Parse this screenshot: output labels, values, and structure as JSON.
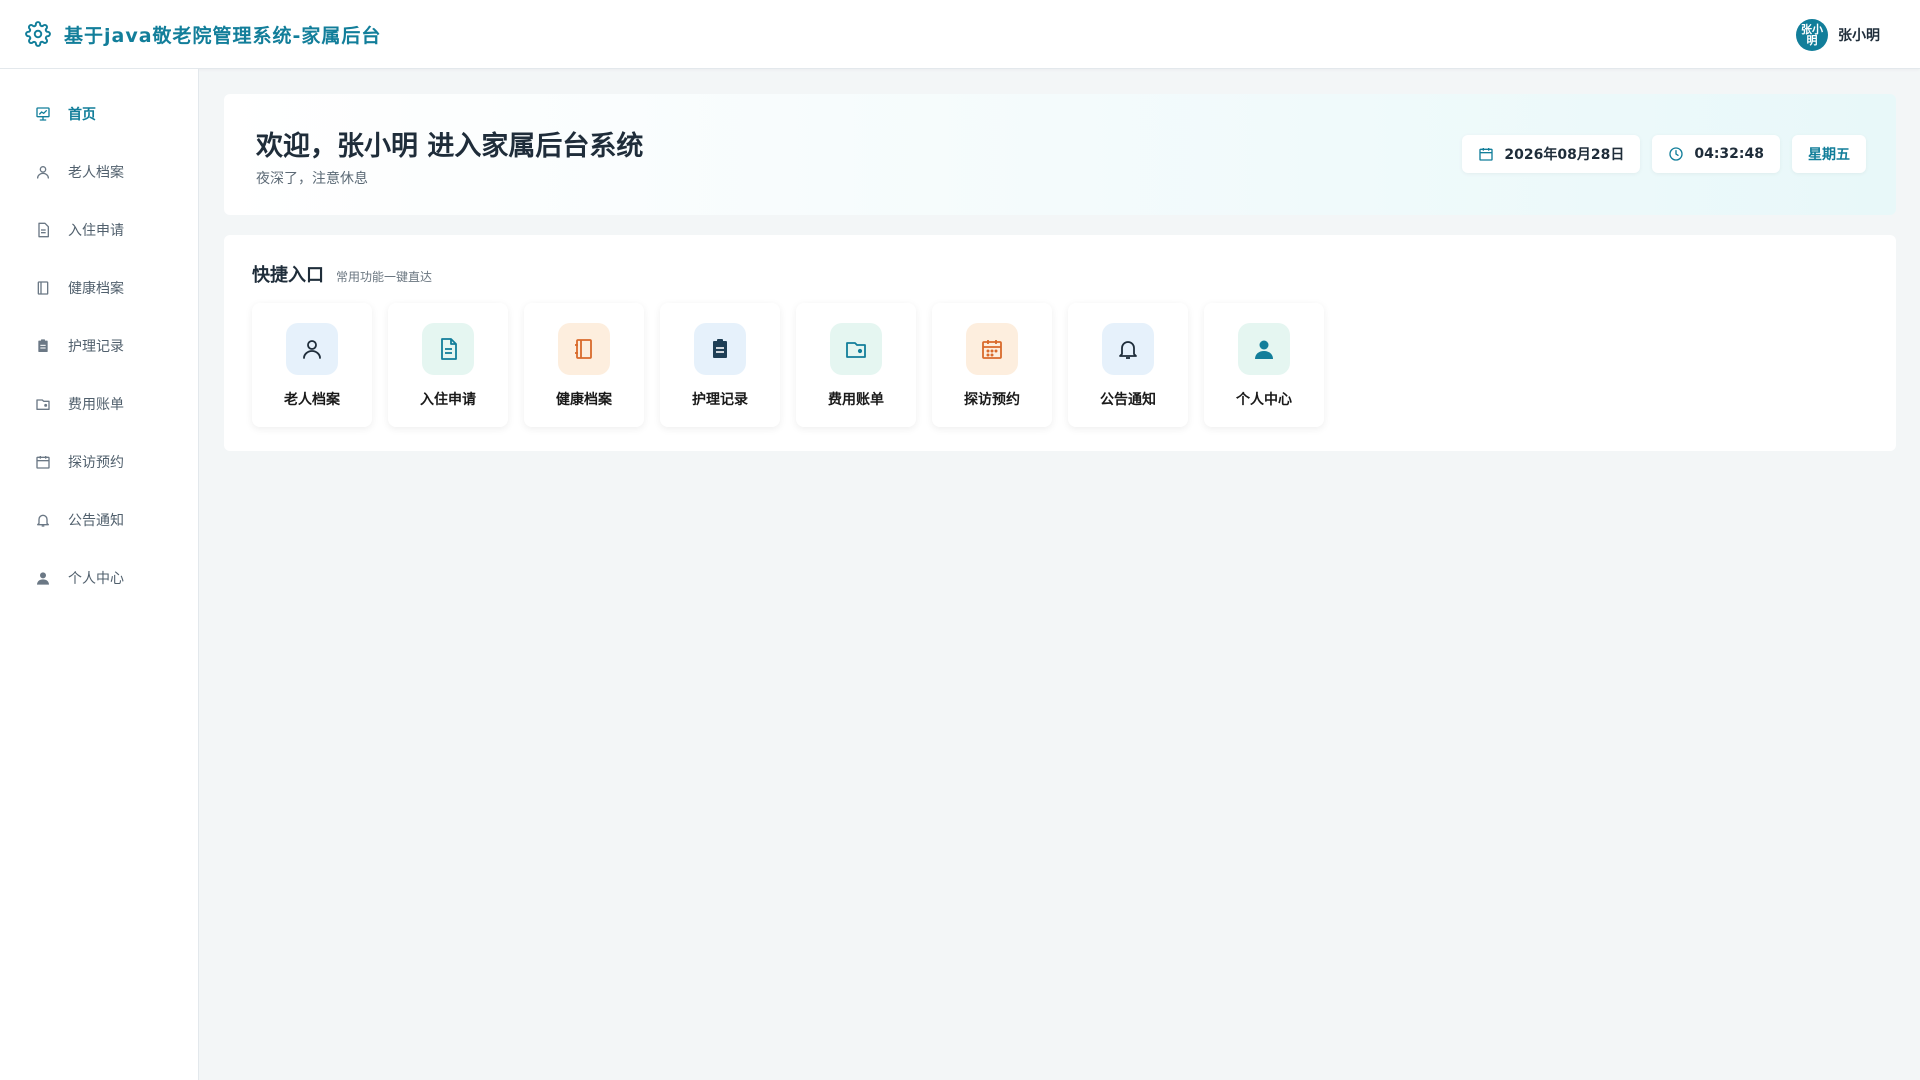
{
  "header": {
    "title": "基于java敬老院管理系统-家属后台",
    "icon": "gear-icon",
    "user": {
      "avatar_text": "张小明",
      "name": "张小明"
    }
  },
  "sidebar": {
    "items": [
      {
        "label": "首页",
        "icon": "home-chart-icon",
        "active": true
      },
      {
        "label": "老人档案",
        "icon": "user-icon"
      },
      {
        "label": "入住申请",
        "icon": "document-icon"
      },
      {
        "label": "健康档案",
        "icon": "notebook-icon"
      },
      {
        "label": "护理记录",
        "icon": "clipboard-icon"
      },
      {
        "label": "费用账单",
        "icon": "wallet-icon"
      },
      {
        "label": "探访预约",
        "icon": "calendar-icon"
      },
      {
        "label": "公告通知",
        "icon": "bell-icon"
      },
      {
        "label": "个人中心",
        "icon": "person-icon"
      }
    ]
  },
  "welcome": {
    "title": "欢迎，张小明 进入家属后台系统",
    "subtitle": "夜深了，注意休息",
    "date": "2026年08月28日",
    "time": "04:32:48",
    "weekday": "星期五"
  },
  "quick": {
    "title": "快捷入口",
    "desc": "常用功能一键直达",
    "tiles": [
      {
        "label": "老人档案",
        "icon": "user-icon"
      },
      {
        "label": "入住申请",
        "icon": "document-icon"
      },
      {
        "label": "健康档案",
        "icon": "notebook-icon"
      },
      {
        "label": "护理记录",
        "icon": "clipboard-icon"
      },
      {
        "label": "费用账单",
        "icon": "wallet-icon"
      },
      {
        "label": "探访预约",
        "icon": "calendar-icon"
      },
      {
        "label": "公告通知",
        "icon": "bell-icon"
      },
      {
        "label": "个人中心",
        "icon": "person-icon"
      }
    ]
  },
  "colors": {
    "accent": "#127e9a",
    "text": "#1f2d3a",
    "orange": "#d96a2b"
  }
}
